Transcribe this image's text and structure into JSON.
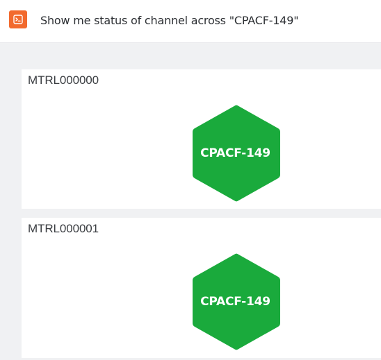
{
  "query": {
    "text": "Show me status of channel across \"CPACF-149\"",
    "icon": "terminal-prompt-icon"
  },
  "panels": [
    {
      "title": "MTRL000000",
      "node": {
        "label": "CPACF-149",
        "shape": "hexagon",
        "status_color": "#1aaa3c"
      }
    },
    {
      "title": "MTRL000001",
      "node": {
        "label": "CPACF-149",
        "shape": "hexagon",
        "status_color": "#1aaa3c"
      }
    }
  ],
  "colors": {
    "accent": "#f26a2e",
    "node_ok": "#1aaa3c"
  }
}
